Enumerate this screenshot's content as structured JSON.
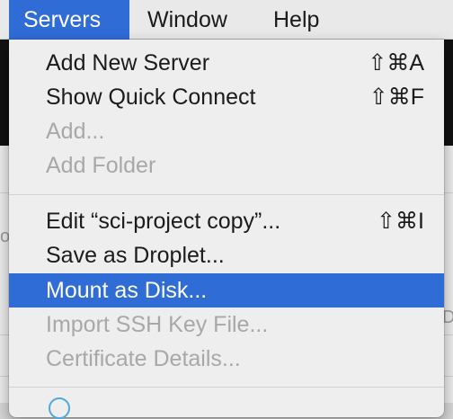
{
  "menubar": {
    "items": [
      {
        "label": "Servers",
        "active": true
      },
      {
        "label": "Window",
        "active": false
      },
      {
        "label": "Help",
        "active": false
      }
    ]
  },
  "background": {
    "fragment_left": "o",
    "fragment_right": "Da"
  },
  "menu": {
    "items": [
      {
        "label": "Add New Server",
        "shortcut": "⇧⌘A",
        "enabled": true
      },
      {
        "label": "Show Quick Connect",
        "shortcut": "⇧⌘F",
        "enabled": true
      },
      {
        "label": "Add...",
        "shortcut": "",
        "enabled": false
      },
      {
        "label": "Add Folder",
        "shortcut": "",
        "enabled": false
      },
      {
        "label": "Edit “sci-project copy”...",
        "shortcut": "⇧⌘I",
        "enabled": true
      },
      {
        "label": "Save as Droplet...",
        "shortcut": "",
        "enabled": true
      },
      {
        "label": "Mount as Disk...",
        "shortcut": "",
        "enabled": true,
        "highlighted": true
      },
      {
        "label": "Import SSH Key File...",
        "shortcut": "",
        "enabled": false
      },
      {
        "label": "Certificate Details...",
        "shortcut": "",
        "enabled": false
      }
    ],
    "highlight_color": "#2f6cd6"
  }
}
